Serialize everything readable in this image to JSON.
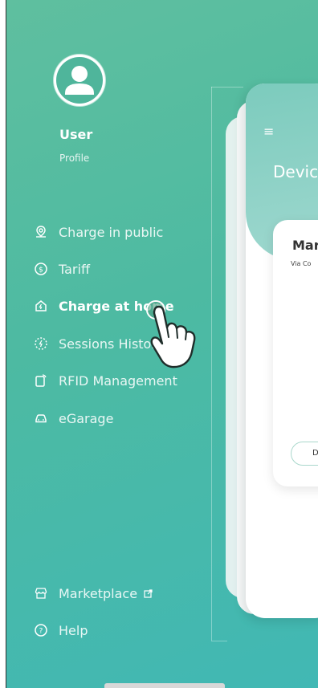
{
  "user": {
    "name": "User",
    "profile_label": "Profile"
  },
  "menu": [
    {
      "label": "Charge in public",
      "icon": "location-pin-icon"
    },
    {
      "label": "Tariff",
      "icon": "dollar-circle-icon"
    },
    {
      "label": "Charge at home",
      "icon": "home-charge-icon",
      "active": true
    },
    {
      "label": "Sessions History",
      "icon": "sessions-history-icon"
    },
    {
      "label": "RFID Management",
      "icon": "rfid-card-icon"
    },
    {
      "label": "eGarage",
      "icon": "car-icon"
    }
  ],
  "bottom_menu": [
    {
      "label": "Marketplace",
      "icon": "store-icon",
      "external_icon": "external-link-icon"
    },
    {
      "label": "Help",
      "icon": "help-circle-icon"
    }
  ],
  "preview": {
    "menu_glyph": "≡",
    "title": "Devic",
    "card_title": "Mar",
    "card_subtitle": "Via Co",
    "card_button": "D"
  },
  "colors": {
    "gradient_start": "#5fbf9f",
    "gradient_end": "#41b8b4",
    "accent_light": "#9fd8cf"
  }
}
